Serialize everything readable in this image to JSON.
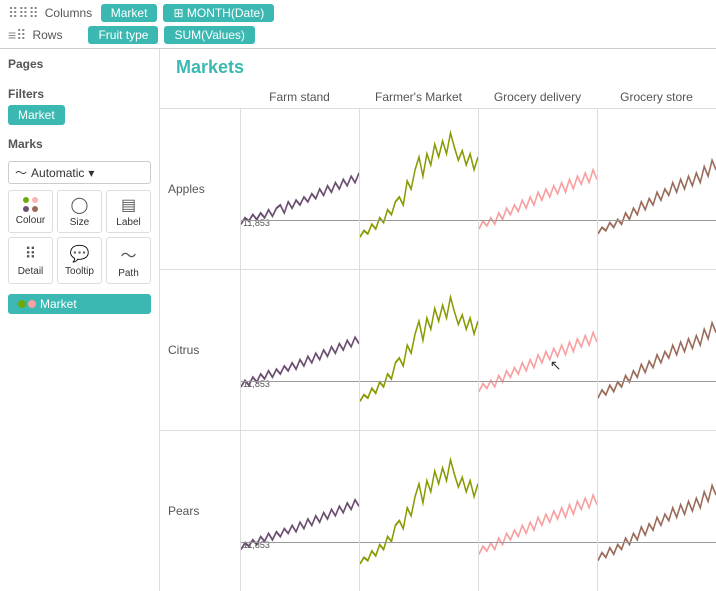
{
  "toolbar": {
    "columns_label": "Columns",
    "rows_label": "Rows",
    "columns_pills": [
      "Market",
      "MONTH(Date)"
    ],
    "rows_pills": [
      "Fruit type",
      "SUM(Values)"
    ],
    "drag_icon": "⠿"
  },
  "sidebar": {
    "pages_label": "Pages",
    "filters_label": "Filters",
    "filter_pill": "Market",
    "marks_label": "Marks",
    "marks_type": "Automatic",
    "mark_buttons": [
      {
        "label": "Colour",
        "name": "colour"
      },
      {
        "label": "Size",
        "name": "size"
      },
      {
        "label": "Label",
        "name": "label"
      },
      {
        "label": "Detail",
        "name": "detail"
      },
      {
        "label": "Tooltip",
        "name": "tooltip"
      },
      {
        "label": "Path",
        "name": "path"
      }
    ],
    "marks_pill": "Market"
  },
  "chart": {
    "title": "Markets",
    "col_headers": [
      "Farm stand",
      "Farmer's Market",
      "Grocery delivery",
      "Grocery store"
    ],
    "row_labels": [
      "Apples",
      "Citrus",
      "Pears"
    ],
    "axis_value": "11,853",
    "colors": {
      "farmstand": "#6b4e71",
      "farmers_market": "#8b9a00",
      "grocery_delivery": "#f8a0a0",
      "grocery_store": "#9b6b5a"
    }
  }
}
